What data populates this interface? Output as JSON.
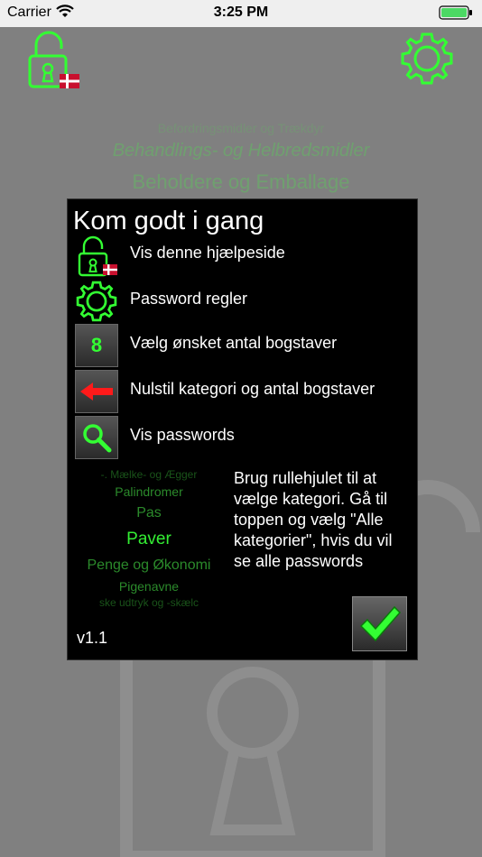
{
  "status_bar": {
    "carrier": "Carrier",
    "time": "3:25 PM"
  },
  "background_categories": [
    "Befordringsmidler og Trækdyr",
    "Behandlings- og Helbredsmidler",
    "Beholdere og Emballage"
  ],
  "dialog": {
    "title": "Kom godt i gang",
    "rows": [
      {
        "icon": "lock-flag-icon",
        "label": "Vis denne hjælpeside"
      },
      {
        "icon": "gear-icon",
        "label": "Password regler"
      },
      {
        "icon": "number-tile-icon",
        "tile_text": "8",
        "label": "Vælg ønsket antal bogstaver"
      },
      {
        "icon": "red-arrow-icon",
        "label": "Nulstil kategori og antal bogstaver"
      },
      {
        "icon": "search-icon",
        "label": "Vis passwords"
      }
    ],
    "picker_items": [
      "-. Mælke- og Ægger",
      "Palindromer",
      "Pas",
      "Paver",
      "Penge og Økonomi",
      "Pigenavne",
      "ske udtryk og -skælc"
    ],
    "info_text": "Brug rullehjulet til at vælge kategori. Gå til toppen og vælg \"Alle kategorier\", hvis du vil se alle passwords",
    "version": "v1.1"
  },
  "colors": {
    "accent_green": "#33ff33",
    "background": "#808080",
    "dialog_bg": "#000000"
  }
}
